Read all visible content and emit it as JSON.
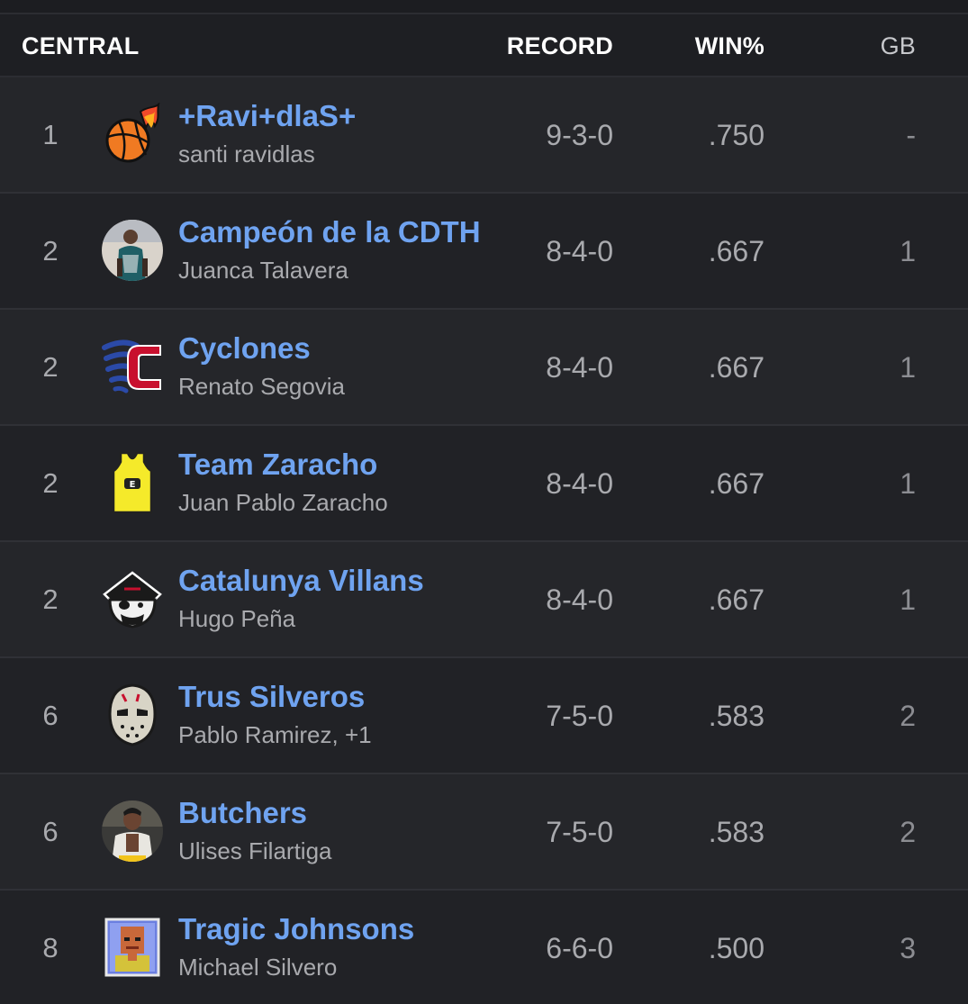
{
  "header": {
    "division": "CENTRAL",
    "record": "RECORD",
    "win_pct": "WIN%",
    "gb": "GB"
  },
  "teams": [
    {
      "rank": "1",
      "name": "+Ravi+dlaS+",
      "owner": "santi ravidlas",
      "record": "9-3-0",
      "win_pct": ".750",
      "gb": "-",
      "logo_icon": "flaming-basketball-icon"
    },
    {
      "rank": "2",
      "name": "Campeón de la CDTH",
      "owner": "Juanca Talavera",
      "record": "8-4-0",
      "win_pct": ".667",
      "gb": "1",
      "logo_icon": "player-photo-avatar"
    },
    {
      "rank": "2",
      "name": "Cyclones",
      "owner": "Renato Segovia",
      "record": "8-4-0",
      "win_pct": ".667",
      "gb": "1",
      "logo_icon": "cyclone-c-icon"
    },
    {
      "rank": "2",
      "name": "Team Zaracho",
      "owner": "Juan Pablo Zaracho",
      "record": "8-4-0",
      "win_pct": ".667",
      "gb": "1",
      "logo_icon": "jersey-icon"
    },
    {
      "rank": "2",
      "name": "Catalunya Villans",
      "owner": "Hugo Peña",
      "record": "8-4-0",
      "win_pct": ".667",
      "gb": "1",
      "logo_icon": "pirate-icon"
    },
    {
      "rank": "6",
      "name": "Trus Silveros",
      "owner": "Pablo Ramirez, +1",
      "record": "7-5-0",
      "win_pct": ".583",
      "gb": "2",
      "logo_icon": "hockey-mask-icon"
    },
    {
      "rank": "6",
      "name": "Butchers",
      "owner": "Ulises Filartiga",
      "record": "7-5-0",
      "win_pct": ".583",
      "gb": "2",
      "logo_icon": "player-photo-avatar"
    },
    {
      "rank": "8",
      "name": "Tragic Johnsons",
      "owner": "Michael Silvero",
      "record": "6-6-0",
      "win_pct": ".500",
      "gb": "3",
      "logo_icon": "pixel-portrait-icon"
    }
  ],
  "colors": {
    "background": "#1c1d21",
    "team_link": "#6fa3f0",
    "secondary_text": "#a9aaae",
    "header_text": "#ffffff"
  }
}
